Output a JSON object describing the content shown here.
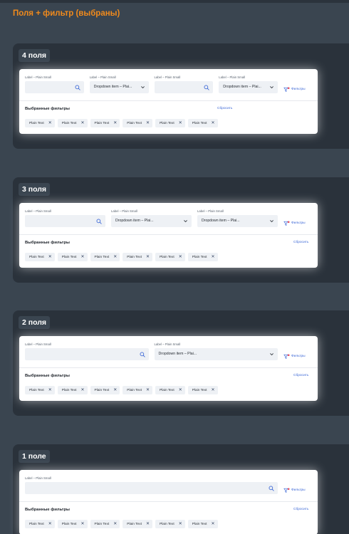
{
  "page_title": "Поля + фильтр (выбраны)",
  "filter_button_label": "Фильтры",
  "selected_filters_title": "Выбранные фильтры",
  "reset_label": "Сбросить",
  "sections": [
    {
      "label": "4 поля",
      "fields": [
        {
          "label": "Label – Plain Small",
          "type": "search",
          "value": ""
        },
        {
          "label": "Label – Plain Small",
          "type": "dropdown",
          "value": "Dropdown item – Plai..."
        },
        {
          "label": "Label – Plain Small",
          "type": "search",
          "value": ""
        },
        {
          "label": "Label – Plain Small",
          "type": "dropdown",
          "value": "Dropdown item – Plai..."
        }
      ],
      "chips": [
        "Plain Text",
        "Plain Text",
        "Plain Text",
        "Plain Text",
        "Plain Text",
        "Plain Text"
      ]
    },
    {
      "label": "3 поля",
      "fields": [
        {
          "label": "Label – Plain Small",
          "type": "search",
          "value": ""
        },
        {
          "label": "Label – Plain Small",
          "type": "dropdown",
          "value": "Dropdown item – Plai..."
        },
        {
          "label": "Label – Plain Small",
          "type": "dropdown",
          "value": "Dropdown item – Plai..."
        }
      ],
      "chips": [
        "Plain Text",
        "Plain Text",
        "Plain Text",
        "Plain Text",
        "Plain Text",
        "Plain Text"
      ]
    },
    {
      "label": "2 поля",
      "fields": [
        {
          "label": "Label – Plain Small",
          "type": "search",
          "value": ""
        },
        {
          "label": "Label – Plain Small",
          "type": "dropdown",
          "value": "Dropdown item – Plai..."
        }
      ],
      "chips": [
        "Plain Text",
        "Plain Text",
        "Plain Text",
        "Plain Text",
        "Plain Text",
        "Plain Text"
      ]
    },
    {
      "label": "1 поле",
      "fields": [
        {
          "label": "Label – Plain Small",
          "type": "search",
          "value": ""
        }
      ],
      "chips": [
        "Plain Text",
        "Plain Text",
        "Plain Text",
        "Plain Text",
        "Plain Text",
        "Plain Text"
      ]
    }
  ],
  "colors": {
    "title_orange": "#f08a1c",
    "link_blue": "#3b67d6",
    "filter_dot_red": "#e5485b"
  },
  "icons": {
    "search": "search-icon",
    "dropdown": "chevron-down-icon",
    "filter": "filter-icon",
    "chip_remove": "close-icon"
  }
}
